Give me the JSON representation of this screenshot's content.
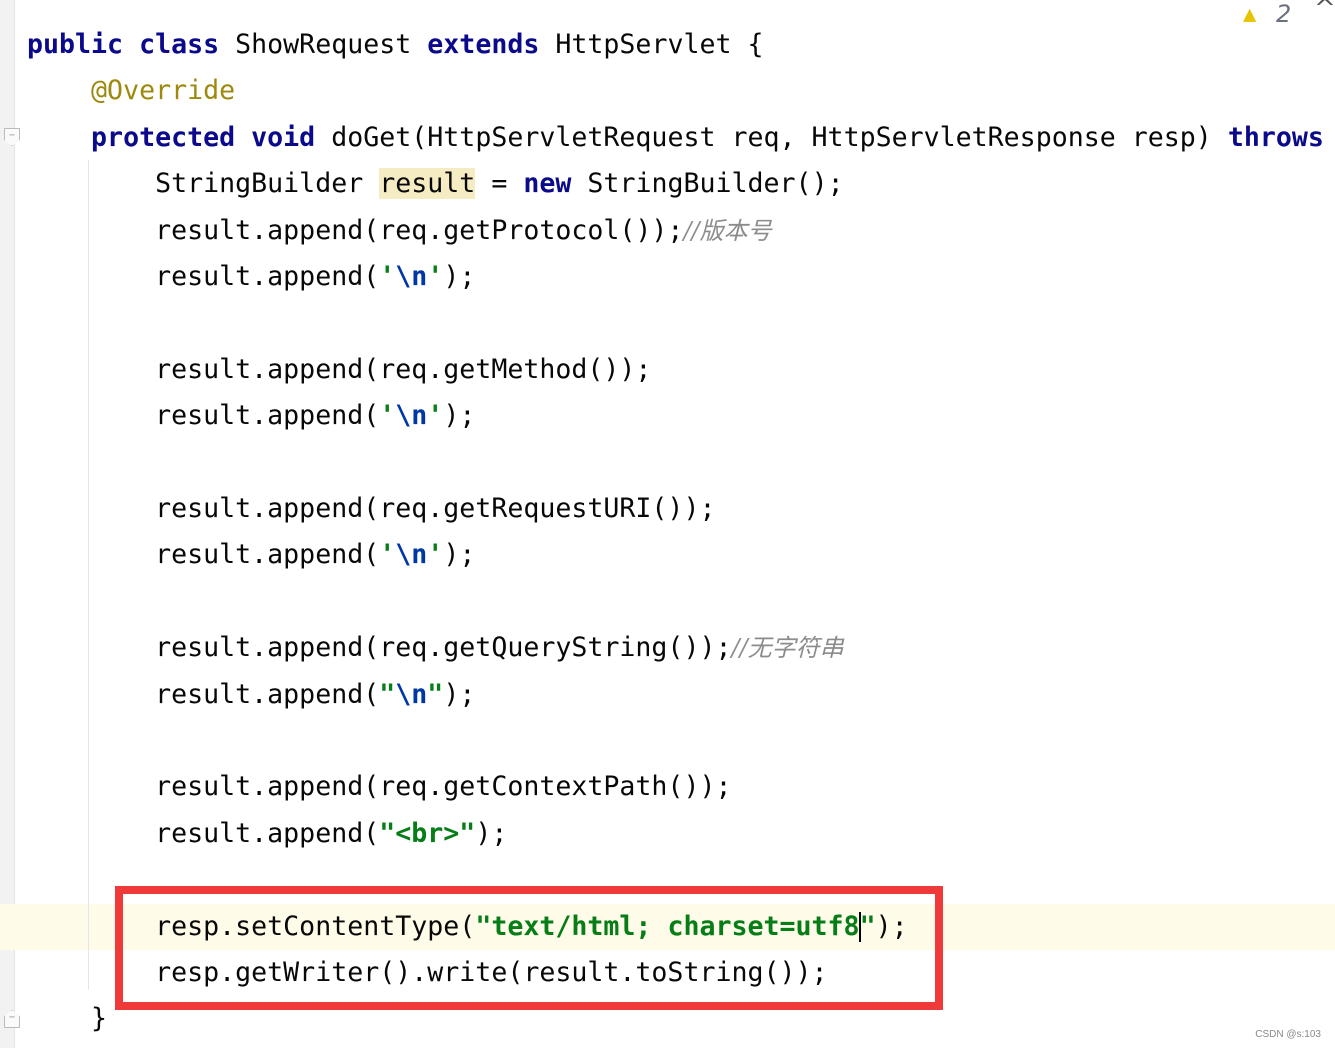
{
  "inspection": {
    "warning_icon": "warning-triangle-icon",
    "warning_count": "2",
    "nav_up_icon": "chevron-up-icon"
  },
  "watermark": "CSDN @s:103",
  "colors": {
    "keyword": "#0a0a8a",
    "annotation": "#9e880d",
    "string": "#067d17",
    "comment": "#8c8c8c",
    "highlight_box": "#f03a3a"
  },
  "code": {
    "lines": [
      [
        [
          "public class ",
          "kw"
        ],
        [
          "ShowRequest ",
          ""
        ],
        [
          "extends ",
          "kw"
        ],
        [
          "HttpServlet {",
          ""
        ]
      ],
      [
        [
          "    ",
          ""
        ],
        [
          "@Override",
          "ann"
        ]
      ],
      [
        [
          "    ",
          ""
        ],
        [
          "protected void ",
          "kw"
        ],
        [
          "doGet(HttpServletRequest req, HttpServletResponse resp) ",
          ""
        ],
        [
          "throws ",
          "kw"
        ]
      ],
      [
        [
          "        StringBuilder ",
          ""
        ],
        [
          "result",
          "hl"
        ],
        [
          " = ",
          ""
        ],
        [
          "new ",
          "kw"
        ],
        [
          "StringBuilder();",
          ""
        ]
      ],
      [
        [
          "        result.append(req.getProtocol());",
          ""
        ],
        [
          "//版本号",
          "cmt"
        ]
      ],
      [
        [
          "        result.append(",
          ""
        ],
        [
          "'",
          "str"
        ],
        [
          "\\n",
          "esc"
        ],
        [
          "'",
          "str"
        ],
        [
          ");",
          ""
        ]
      ],
      [],
      [
        [
          "        result.append(req.getMethod());",
          ""
        ]
      ],
      [
        [
          "        result.append(",
          ""
        ],
        [
          "'",
          "str"
        ],
        [
          "\\n",
          "esc"
        ],
        [
          "'",
          "str"
        ],
        [
          ");",
          ""
        ]
      ],
      [],
      [
        [
          "        result.append(req.getRequestURI());",
          ""
        ]
      ],
      [
        [
          "        result.append(",
          ""
        ],
        [
          "'",
          "str"
        ],
        [
          "\\n",
          "esc"
        ],
        [
          "'",
          "str"
        ],
        [
          ");",
          ""
        ]
      ],
      [],
      [
        [
          "        result.append(req.getQueryString());",
          ""
        ],
        [
          "//无字符串",
          "cmt"
        ]
      ],
      [
        [
          "        result.append(",
          ""
        ],
        [
          "\"",
          "str"
        ],
        [
          "\\n",
          "esc"
        ],
        [
          "\"",
          "str"
        ],
        [
          ");",
          ""
        ]
      ],
      [],
      [
        [
          "        result.append(req.getContextPath());",
          ""
        ]
      ],
      [
        [
          "        result.append(",
          ""
        ],
        [
          "\"<br>\"",
          "str"
        ],
        [
          ");",
          ""
        ]
      ],
      [],
      [
        [
          "        resp.setContentType(",
          ""
        ],
        [
          "\"text/html; charset=utf8",
          "str"
        ],
        [
          "|",
          "caret"
        ],
        [
          "\"",
          "str"
        ],
        [
          ");",
          ""
        ]
      ],
      [
        [
          "        resp.getWriter().write(result.toString());",
          ""
        ]
      ],
      [
        [
          "    }",
          ""
        ]
      ]
    ]
  }
}
